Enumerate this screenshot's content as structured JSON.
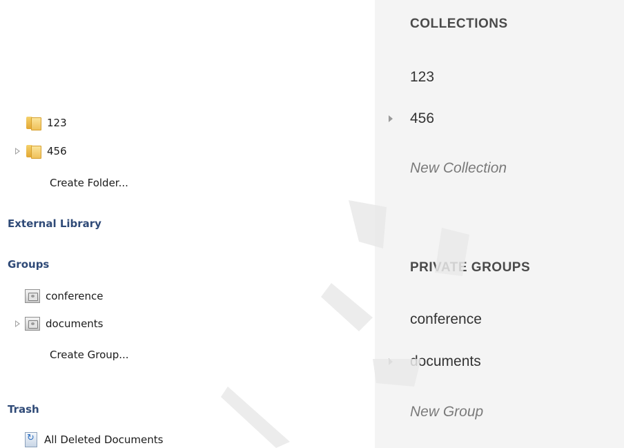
{
  "left_pane": {
    "folders": [
      {
        "label": "123",
        "expandable": false
      },
      {
        "label": "456",
        "expandable": true
      }
    ],
    "create_folder": "Create Folder...",
    "external_library": "External Library",
    "groups_heading": "Groups",
    "groups": [
      {
        "label": "conference",
        "expandable": false
      },
      {
        "label": "documents",
        "expandable": true
      }
    ],
    "create_group": "Create Group...",
    "trash_heading": "Trash",
    "trash_item": "All Deleted Documents",
    "icons": {
      "folder": "folder-icon",
      "group": "group-icon",
      "trash": "recycle-document-icon",
      "expander": "expand-triangle-icon"
    },
    "colors": {
      "heading": "#2f4a77"
    }
  },
  "right_pane": {
    "collections_title": "COLLECTIONS",
    "collections": [
      {
        "label": "123",
        "expandable": false
      },
      {
        "label": "456",
        "expandable": true
      }
    ],
    "new_collection": "New Collection",
    "groups_title": "PRIVATE GROUPS",
    "groups": [
      {
        "label": "conference",
        "expandable": false
      },
      {
        "label": "documents",
        "expandable": true
      }
    ],
    "new_group": "New Group",
    "colors": {
      "background": "#f4f4f4",
      "title": "#4a4a4a",
      "placeholder": "#7a7a7a"
    }
  }
}
